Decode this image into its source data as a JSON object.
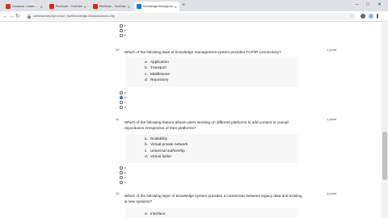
{
  "browser": {
    "tabs": [
      {
        "title": "Coursera - Learn...",
        "favicon_color": "#d93025",
        "active": false
      },
      {
        "title": "Pin/Zoom - YouTube Video...",
        "favicon_color": "#e62117",
        "active": false
      },
      {
        "title": "Pin/Zoom - YouTube Video...",
        "favicon_color": "#e62117",
        "active": false
      },
      {
        "title": "Knowledge Management - Qu...",
        "favicon_color": "#1a73e8",
        "active": true
      }
    ],
    "new_tab_symbol": "+",
    "window_controls": [
      "–",
      "□",
      "✕"
    ],
    "url": "onlinesurvey.fupl.in/sort_fupl/knowledge-MAssessment-1/fig",
    "nav": {
      "back": "←",
      "forward": "→",
      "reload": "↻"
    }
  },
  "colors": {
    "accent": "#4a6fd1",
    "option_bg": "#f7f7f7"
  },
  "top_radios": [
    {
      "label": "b",
      "checked": false
    },
    {
      "label": "c",
      "checked": false
    },
    {
      "label": "d",
      "checked": false
    }
  ],
  "questions": [
    {
      "number": "10.",
      "text": "Which of the following laws of knowledge management system provides TCP/IP connectivity?",
      "points": "1 point",
      "options": [
        {
          "letter": "a.",
          "text": "Application",
          "italic": false
        },
        {
          "letter": "b.",
          "text": "Transport",
          "italic": false
        },
        {
          "letter": "c.",
          "text": "Middleware",
          "italic": false
        },
        {
          "letter": "d.",
          "text": "Repository",
          "italic": false
        }
      ],
      "choices": [
        {
          "label": "a",
          "checked": false
        },
        {
          "label": "b",
          "checked": true
        },
        {
          "label": "c",
          "checked": false
        },
        {
          "label": "d",
          "checked": false
        }
      ]
    },
    {
      "number": "11.",
      "text": "Which of the following feature allows users working on different platforms to add content to overall repositories irrespective of their platforms?",
      "points": "1 point",
      "options": [
        {
          "letter": "a.",
          "text": "Scalability",
          "italic": false
        },
        {
          "letter": "b.",
          "text": "Virtual private network",
          "italic": false
        },
        {
          "letter": "c.",
          "text": "Universal authorship",
          "italic": true
        },
        {
          "letter": "d.",
          "text": "Virtual folder",
          "italic": true
        }
      ],
      "choices": [
        {
          "label": "a",
          "checked": false
        },
        {
          "label": "b",
          "checked": false
        },
        {
          "label": "c",
          "checked": false
        },
        {
          "label": "d",
          "checked": false
        }
      ]
    },
    {
      "number": "12.",
      "text": "Which of the following layer of knowledge system provides a connection between legacy data and existing & new systems?",
      "points": "1 point",
      "options": [
        {
          "letter": "a.",
          "text": "Interface",
          "italic": false
        }
      ]
    }
  ]
}
